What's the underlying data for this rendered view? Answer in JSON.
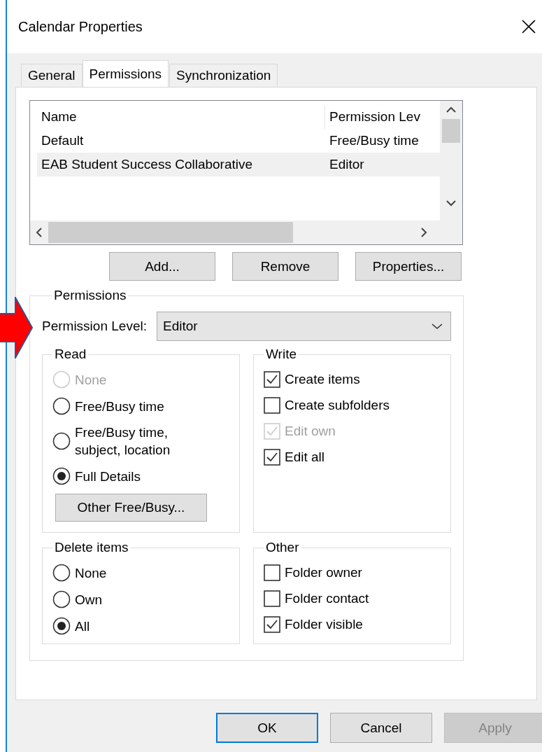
{
  "window": {
    "title": "Calendar Properties"
  },
  "tabs": [
    {
      "label": "General",
      "selected": false
    },
    {
      "label": "Permissions",
      "selected": true
    },
    {
      "label": "Synchronization",
      "selected": false
    }
  ],
  "list": {
    "columns": [
      "Name",
      "Permission Lev"
    ],
    "rows": [
      {
        "name": "Default",
        "permission": "Free/Busy time",
        "selected": false
      },
      {
        "name": "EAB Student Success Collaborative",
        "permission": "Editor",
        "selected": true
      }
    ]
  },
  "list_buttons": [
    "Add...",
    "Remove",
    "Properties..."
  ],
  "permissions": {
    "title": "Permissions",
    "level_label": "Permission Level:",
    "level_value": "Editor",
    "read": {
      "title": "Read",
      "options": [
        {
          "label": "None",
          "selected": false,
          "disabled": true
        },
        {
          "label": "Free/Busy time",
          "selected": false,
          "disabled": false
        },
        {
          "label": "Free/Busy time,\nsubject, location",
          "selected": false,
          "disabled": false
        },
        {
          "label": "Full Details",
          "selected": true,
          "disabled": false
        }
      ],
      "button": "Other Free/Busy..."
    },
    "write": {
      "title": "Write",
      "items": [
        {
          "label": "Create items",
          "checked": true,
          "disabled": false
        },
        {
          "label": "Create subfolders",
          "checked": false,
          "disabled": false
        },
        {
          "label": "Edit own",
          "checked": true,
          "disabled": true
        },
        {
          "label": "Edit all",
          "checked": true,
          "disabled": false
        }
      ]
    },
    "delete": {
      "title": "Delete items",
      "options": [
        {
          "label": "None",
          "selected": false,
          "disabled": false
        },
        {
          "label": "Own",
          "selected": false,
          "disabled": false
        },
        {
          "label": "All",
          "selected": true,
          "disabled": false
        }
      ]
    },
    "other": {
      "title": "Other",
      "items": [
        {
          "label": "Folder owner",
          "checked": false,
          "disabled": false
        },
        {
          "label": "Folder contact",
          "checked": false,
          "disabled": false
        },
        {
          "label": "Folder visible",
          "checked": true,
          "disabled": false
        }
      ]
    }
  },
  "footer_buttons": [
    {
      "label": "OK",
      "default": true,
      "disabled": false
    },
    {
      "label": "Cancel",
      "default": false,
      "disabled": false
    },
    {
      "label": "Apply",
      "default": false,
      "disabled": true
    }
  ]
}
